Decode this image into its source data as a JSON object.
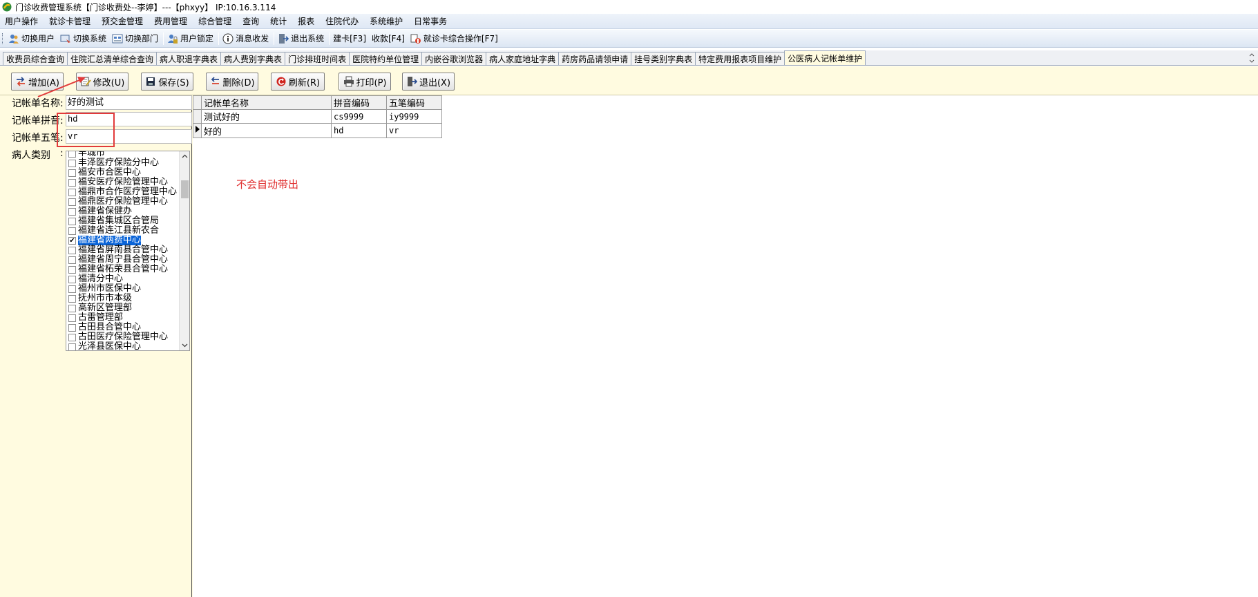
{
  "window": {
    "title": "门诊收费管理系统【门诊收费处--李婷】---【phxyy】 IP:10.16.3.114"
  },
  "menubar": {
    "items": [
      "用户操作",
      "就诊卡管理",
      "预交金管理",
      "费用管理",
      "综合管理",
      "查询",
      "统计",
      "报表",
      "住院代办",
      "系统维护",
      "日常事务"
    ]
  },
  "toolbar": {
    "switch_user": "切换用户",
    "switch_system": "切换系统",
    "switch_dept": "切换部门",
    "lock_user": "用户锁定",
    "messages": "消息收发",
    "exit_system": "退出系统",
    "create_card": "建卡[F3]",
    "charge": "收款[F4]",
    "card_ops": "就诊卡综合操作[F7]"
  },
  "tabs": [
    "收费员综合查询",
    "住院汇总清单综合查询",
    "病人职退字典表",
    "病人费别字典表",
    "门诊排班时间表",
    "医院特约单位管理",
    "内嵌谷歌浏览器",
    "病人家庭地址字典",
    "药房药品请领申请",
    "挂号类别字典表",
    "特定费用报表项目维护",
    "公医病人记帐单维护"
  ],
  "active_tab_index": 11,
  "actions": {
    "add": "增加(A)",
    "modify": "修改(U)",
    "save": "保存(S)",
    "delete": "删除(D)",
    "refresh": "刷新(R)",
    "print": "打印(P)",
    "exit": "退出(X)"
  },
  "form": {
    "name_label": "记帐单名称:",
    "name_value": "好的测试",
    "pinyin_label": "记帐单拼音:",
    "pinyin_value": "hd",
    "wubi_label": "记帐单五笔:",
    "wubi_value": "vr",
    "patient_type_label": "病人类别",
    "patient_type_colon": ":"
  },
  "patient_types": [
    {
      "label": "丰城市",
      "checked": false
    },
    {
      "label": "丰泽医疗保险分中心",
      "checked": false
    },
    {
      "label": "福安市合医中心",
      "checked": false
    },
    {
      "label": "福安医疗保险管理中心",
      "checked": false
    },
    {
      "label": "福鼎市合作医疗管理中心",
      "checked": false
    },
    {
      "label": "福鼎医疗保险管理中心",
      "checked": false
    },
    {
      "label": "福建省保健办",
      "checked": false
    },
    {
      "label": "福建省集城区合管局",
      "checked": false
    },
    {
      "label": "福建省连江县新农合",
      "checked": false
    },
    {
      "label": "福建省两费中心",
      "checked": true,
      "selected": true
    },
    {
      "label": "福建省屏南县合管中心",
      "checked": false
    },
    {
      "label": "福建省周宁县合管中心",
      "checked": false
    },
    {
      "label": "福建省柘荣县合管中心",
      "checked": false
    },
    {
      "label": "福清分中心",
      "checked": false
    },
    {
      "label": "福州市医保中心",
      "checked": false
    },
    {
      "label": "抚州市市本级",
      "checked": false
    },
    {
      "label": "高新区管理部",
      "checked": false
    },
    {
      "label": "古雷管理部",
      "checked": false
    },
    {
      "label": "古田县合管中心",
      "checked": false
    },
    {
      "label": "古田医疗保险管理中心",
      "checked": false
    },
    {
      "label": "光泽县医保中心",
      "checked": false
    }
  ],
  "grid": {
    "columns": [
      "记帐单名称",
      "拼音编码",
      "五笔编码"
    ],
    "rows": [
      [
        "测试好的",
        "cs9999",
        "iy9999"
      ],
      [
        "好的",
        "hd",
        "vr"
      ]
    ],
    "current_row": 1
  },
  "annotation": "不会自动带出",
  "colors": {
    "workarea_bg": "#fffbe0",
    "annotation_red": "#e03030",
    "selection_blue": "#0a64d8"
  }
}
